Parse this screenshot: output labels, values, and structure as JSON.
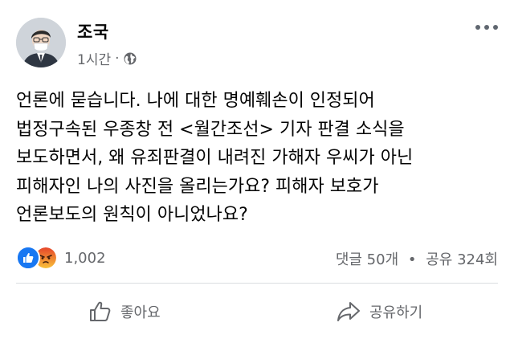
{
  "post": {
    "author": "조국",
    "time": "1시간",
    "separator": "·",
    "audience_icon": "globe-icon",
    "text_lines": [
      "언론에 묻습니다. 나에 대한 명예훼손이 인정되어",
      "법정구속된 우종창 전 <월간조선> 기자 판결 소식을",
      "보도하면서, 왜 유죄판결이 내려진 가해자 우씨가 아닌",
      "피해자인 나의 사진을 올리는가요? 피해자 보호가",
      "언론보도의 원칙이 아니었나요?"
    ]
  },
  "reactions": {
    "icons": [
      "like-icon",
      "angry-icon"
    ],
    "count": "1,002"
  },
  "stats": {
    "comments": "댓글 50개",
    "separator": "•",
    "shares": "공유 324회"
  },
  "actions": {
    "like_label": "좋아요",
    "share_label": "공유하기"
  },
  "colors": {
    "text": "#050505",
    "secondary": "#65676b",
    "like_blue": "#1877f2",
    "angry_orange": "#f0643c",
    "divider": "#dadde1"
  }
}
